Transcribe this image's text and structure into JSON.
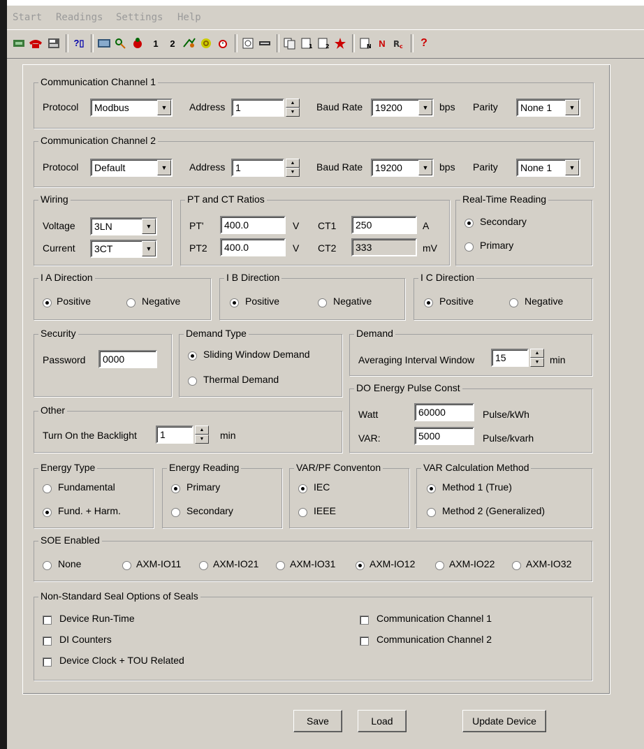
{
  "menu": {
    "start": "Start",
    "readings": "Readings",
    "settings": "Settings",
    "help": "Help"
  },
  "toolbar": {
    "btn1": "1",
    "btn2": "2",
    "n": "N",
    "help": "?"
  },
  "comm1": {
    "title": "Communication Channel 1",
    "protocol_label": "Protocol",
    "protocol": "Modbus",
    "address_label": "Address",
    "address": "1",
    "baud_label": "Baud Rate",
    "baud": "19200",
    "bps": "bps",
    "parity_label": "Parity",
    "parity": "None 1"
  },
  "comm2": {
    "title": "Communication Channel 2",
    "protocol_label": "Protocol",
    "protocol": "Default",
    "address_label": "Address",
    "address": "1",
    "baud_label": "Baud Rate",
    "baud": "19200",
    "bps": "bps",
    "parity_label": "Parity",
    "parity": "None 1"
  },
  "wiring": {
    "title": "Wiring",
    "voltage_label": "Voltage",
    "voltage": "3LN",
    "current_label": "Current",
    "current": "3CT"
  },
  "ratios": {
    "title": "PT and CT Ratios",
    "pt1_label": "PT'",
    "pt1": "400.0",
    "pt2_label": "PT2",
    "pt2": "400.0",
    "v": "V",
    "ct1_label": "CT1",
    "ct1": "250",
    "ct1_unit": "A",
    "ct2_label": "CT2",
    "ct2": "333",
    "ct2_unit": "mV"
  },
  "realtime": {
    "title": "Real-Time Reading",
    "secondary": "Secondary",
    "primary": "Primary"
  },
  "ia": {
    "title": "I A Direction",
    "pos": "Positive",
    "neg": "Negative"
  },
  "ib": {
    "title": "I B Direction",
    "pos": "Positive",
    "neg": "Negative"
  },
  "ic": {
    "title": "I C Direction",
    "pos": "Positive",
    "neg": "Negative"
  },
  "security": {
    "title": "Security",
    "password_label": "Password",
    "password": "0000"
  },
  "demand_type": {
    "title": "Demand Type",
    "sliding": "Sliding Window Demand",
    "thermal": "Thermal Demand"
  },
  "demand": {
    "title": "Demand",
    "interval_label": "Averaging Interval Window",
    "interval": "15",
    "unit": "min"
  },
  "do_pulse": {
    "title": "DO Energy Pulse Const",
    "watt_label": "Watt",
    "watt": "60000",
    "watt_unit": "Pulse/kWh",
    "var_label": "VAR:",
    "var": "5000",
    "var_unit": "Pulse/kvarh"
  },
  "other": {
    "title": "Other",
    "backlight_label": "Turn On the Backlight",
    "backlight": "1",
    "unit": "min"
  },
  "energy_type": {
    "title": "Energy Type",
    "fundamental": "Fundamental",
    "fund_harm": "Fund. + Harm."
  },
  "energy_reading": {
    "title": "Energy Reading",
    "primary": "Primary",
    "secondary": "Secondary"
  },
  "varpf": {
    "title": "VAR/PF Conventon",
    "iec": "IEC",
    "ieee": "IEEE"
  },
  "varcalc": {
    "title": "VAR Calculation Method",
    "m1": "Method 1 (True)",
    "m2": "Method 2 (Generalized)"
  },
  "soe": {
    "title": "SOE Enabled",
    "none": "None",
    "o1": "AXM-IO11",
    "o2": "AXM-IO21",
    "o3": "AXM-IO31",
    "o4": "AXM-IO12",
    "o5": "AXM-IO22",
    "o6": "AXM-IO32"
  },
  "seals": {
    "title": "Non-Standard Seal Options of Seals",
    "runtime": "Device Run-Time",
    "di": "DI Counters",
    "clock": "Device Clock + TOU Related",
    "comm1": "Communication Channel 1",
    "comm2": "Communication Channel 2"
  },
  "buttons": {
    "save": "Save",
    "load": "Load",
    "update": "Update Device"
  }
}
